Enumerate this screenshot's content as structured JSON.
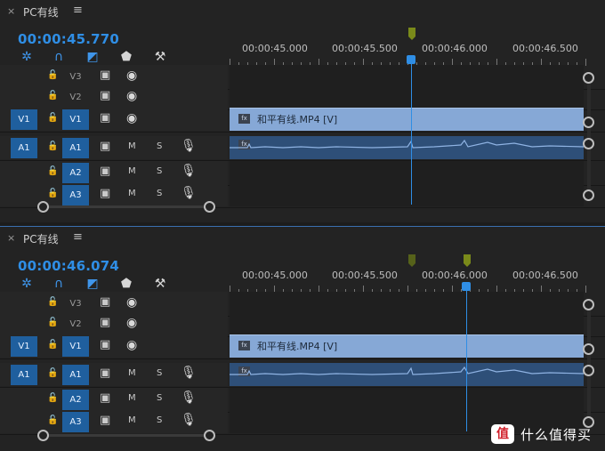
{
  "panel1": {
    "close_label": "×",
    "title": "PC有线",
    "menu_label": "≡",
    "timecode": "00:00:45.770",
    "ruler": [
      "00:00:45.000",
      "00:00:45.500",
      "00:00:46.000",
      "00:00:46.500"
    ],
    "tracks": {
      "v3": {
        "src": "",
        "name": "V3"
      },
      "v2": {
        "src": "",
        "name": "V2"
      },
      "v1": {
        "src": "V1",
        "name": "V1"
      },
      "a1": {
        "src": "A1",
        "name": "A1",
        "m": "M",
        "s": "S"
      },
      "a2": {
        "src": "",
        "name": "A2",
        "m": "M",
        "s": "S"
      },
      "a3": {
        "src": "",
        "name": "A3",
        "m": "M",
        "s": "S"
      }
    },
    "video_clip": "和平有线.MP4 [V]",
    "fx_badge": "fx"
  },
  "panel2": {
    "close_label": "×",
    "title": "PC有线",
    "menu_label": "≡",
    "timecode": "00:00:46.074",
    "ruler": [
      "00:00:45.000",
      "00:00:45.500",
      "00:00:46.000",
      "00:00:46.500"
    ],
    "tracks": {
      "v3": {
        "src": "",
        "name": "V3"
      },
      "v2": {
        "src": "",
        "name": "V2"
      },
      "v1": {
        "src": "V1",
        "name": "V1"
      },
      "a1": {
        "src": "A1",
        "name": "A1",
        "m": "M",
        "s": "S"
      },
      "a2": {
        "src": "",
        "name": "A2",
        "m": "M",
        "s": "S"
      },
      "a3": {
        "src": "",
        "name": "A3",
        "m": "M",
        "s": "S"
      }
    },
    "video_clip": "和平有线.MP4 [V]",
    "fx_badge": "fx"
  },
  "watermark": {
    "logo": "值",
    "text": "什么值得买"
  },
  "colors": {
    "accent": "#2f8ee5",
    "target_on": "#1f5f9e",
    "video_clip": "#86a8d6",
    "audio_clip": "#2e4f78",
    "work_area": "#e6d11e",
    "marker": "#7a8a1a"
  },
  "icons": [
    "close-icon",
    "panel-menu-icon",
    "snap-icon",
    "magnet-icon",
    "linked-selection-icon",
    "add-marker-icon",
    "wrench-icon",
    "lock-icon",
    "camera-toggle-icon",
    "eye-icon",
    "mic-icon",
    "playhead-icon",
    "marker-icon",
    "fx-icon"
  ]
}
